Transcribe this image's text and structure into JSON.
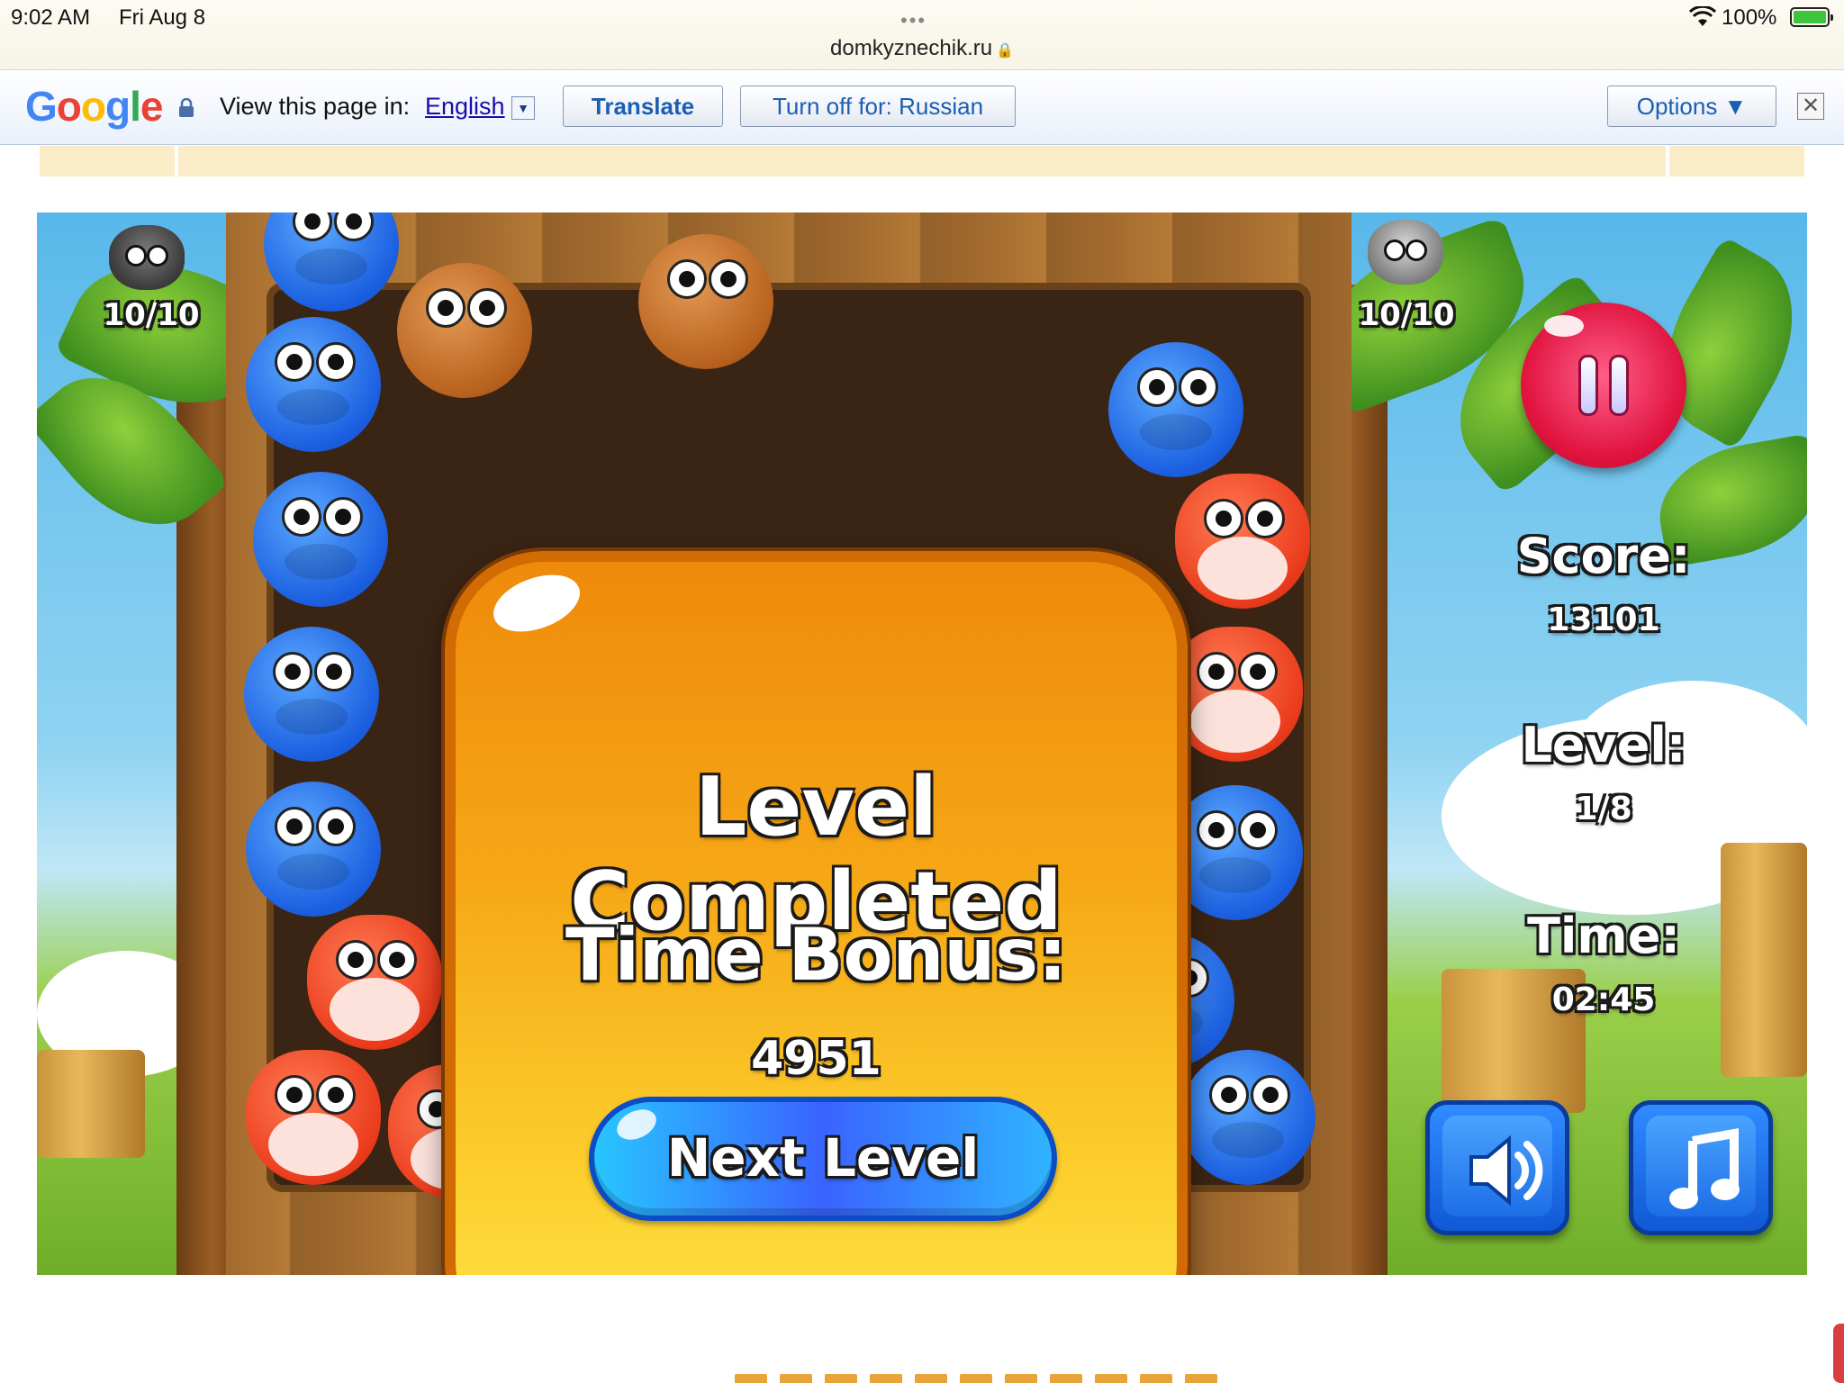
{
  "statusbar": {
    "time": "9:02 AM",
    "date": "Fri Aug 8",
    "url": "domkyznechik.ru",
    "battery": "100%",
    "battery_level": 1.0
  },
  "translate_bar": {
    "prompt": "View this page in:",
    "language": "English",
    "translate_label": "Translate",
    "turn_off_label": "Turn off for: Russian",
    "options_label": "Options ▼",
    "close_glyph": "✕"
  },
  "game": {
    "boar_count": "10/10",
    "raccoon_count": "10/10",
    "score_label": "Score:",
    "score_value": "13101",
    "level_label": "Level:",
    "level_value": "1/8",
    "time_label": "Time:",
    "time_value": "02:45",
    "icons": {
      "pause": "pause-icon",
      "sound": "speaker-icon",
      "music": "music-note-icon"
    }
  },
  "dialog": {
    "title": "Level Completed",
    "bonus_label": "Time Bonus:",
    "bonus_value": "4951",
    "next_label": "Next Level"
  },
  "colors": {
    "dialog_orange": "#f6a716",
    "pause_red": "#e0143f",
    "button_blue": "#1158d6",
    "board_dark": "#3a2414"
  }
}
